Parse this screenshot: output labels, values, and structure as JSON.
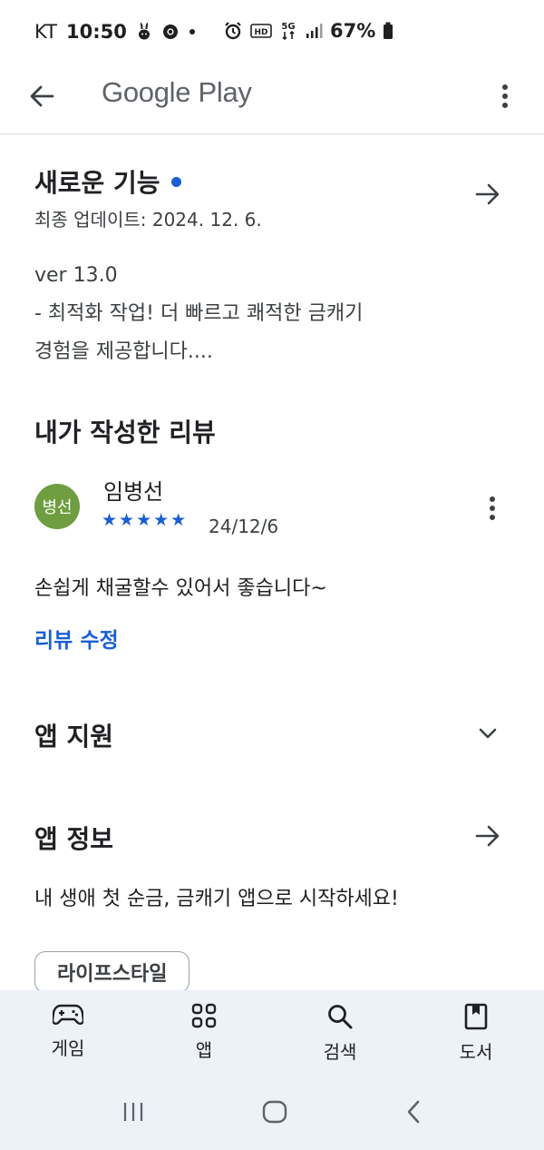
{
  "status_bar": {
    "carrier": "KT",
    "time": "10:50",
    "battery": "67%"
  },
  "app_bar": {
    "brand": "Google Play"
  },
  "whats_new": {
    "title": "새로운 기능",
    "updated": "최종 업데이트: 2024. 12. 6.",
    "notes": "ver 13.0\n- 최적화 작업! 더 빠르고 쾌적한 금캐기\n경험을 제공합니다...."
  },
  "my_review": {
    "title": "내가 작성한 리뷰",
    "avatar_text": "병선",
    "reviewer_name": "임병선",
    "stars": "★★★★★",
    "rating": 5,
    "date": "24/12/6",
    "text": "손쉽게 채굴할수 있어서 좋습니다~",
    "edit_label": "리뷰 수정"
  },
  "app_support": {
    "title": "앱 지원"
  },
  "app_info": {
    "title": "앱 정보",
    "description": "내 생애 첫 순금, 금캐기 앱으로 시작하세요!",
    "category_chip": "라이프스타일"
  },
  "bottom_nav": [
    {
      "label": "게임",
      "icon": "gamepad-icon"
    },
    {
      "label": "앱",
      "icon": "apps-grid-icon"
    },
    {
      "label": "검색",
      "icon": "search-icon"
    },
    {
      "label": "도서",
      "icon": "book-icon"
    }
  ],
  "colors": {
    "accent": "#1a5fd1",
    "avatar": "#6e9e3f",
    "nav_bg": "#edf1f8"
  }
}
